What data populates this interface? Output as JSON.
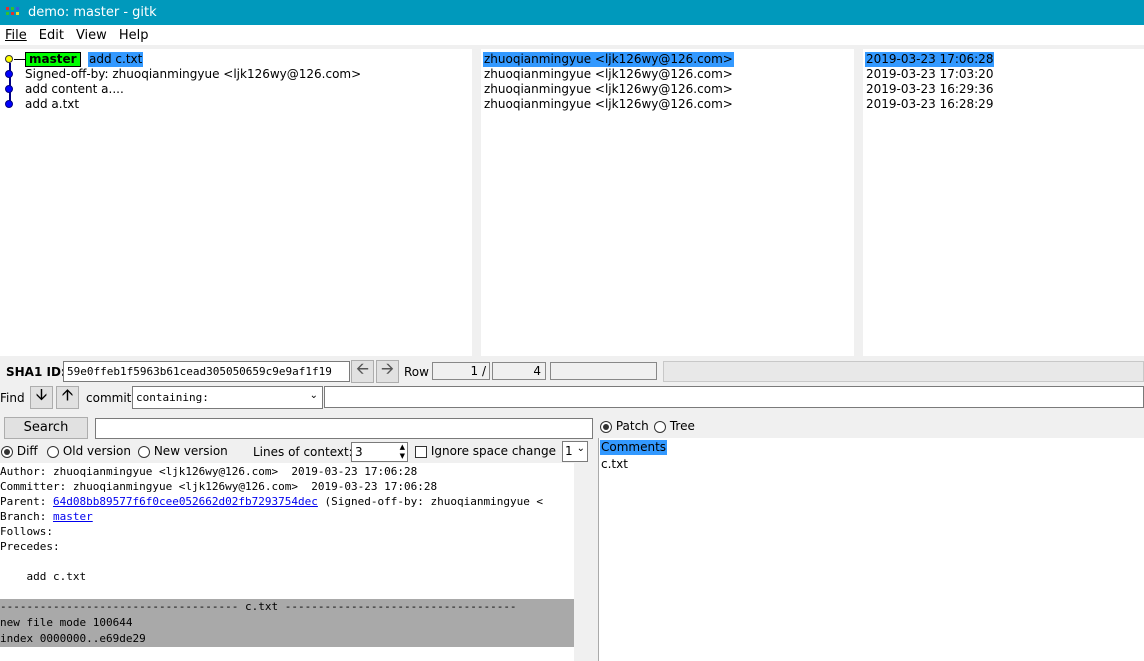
{
  "window": {
    "title": "demo: master - gitk"
  },
  "menu": [
    "File",
    "Edit",
    "View",
    "Help"
  ],
  "commits": [
    {
      "subject": "add c.txt",
      "branch": "master",
      "author": "zhuoqianmingyue <ljk126wy@126.com>",
      "date": "2019-03-23 17:06:28",
      "selected": true,
      "head": true
    },
    {
      "subject": "Signed-off-by: zhuoqianmingyue <ljk126wy@126.com>",
      "author": "zhuoqianmingyue <ljk126wy@126.com>",
      "date": "2019-03-23 17:03:20"
    },
    {
      "subject": "add content a....",
      "author": "zhuoqianmingyue <ljk126wy@126.com>",
      "date": "2019-03-23 16:29:36"
    },
    {
      "subject": "add a.txt",
      "author": "zhuoqianmingyue <ljk126wy@126.com>",
      "date": "2019-03-23 16:28:29"
    }
  ],
  "sha_bar": {
    "label": "SHA1 ID:",
    "value": "59e0ffeb1f5963b61cead305050659c9e9af1f19",
    "row_label": "Row",
    "row_current": "1 /",
    "row_total": "4"
  },
  "find_bar": {
    "find_label": "Find",
    "commit_label": "commit",
    "mode": "containing:",
    "query": ""
  },
  "search": {
    "button": "Search",
    "query": "",
    "diff_label": "Diff",
    "old_version_label": "Old version",
    "new_version_label": "New version",
    "context_label": "Lines of context:",
    "context_value": "3",
    "ignore_space_label": "Ignore space change",
    "extra_select": "1"
  },
  "details": {
    "author": "Author: zhuoqianmingyue <ljk126wy@126.com>  2019-03-23 17:06:28",
    "committer": "Committer: zhuoqianmingyue <ljk126wy@126.com>  2019-03-23 17:06:28",
    "parent_label": "Parent: ",
    "parent_sha": "64d08bb89577f6f0cee052662d02fb7293754dec",
    "parent_tail": " (Signed-off-by: zhuoqianmingyue <",
    "branch_label": "Branch: ",
    "branch_value": "master",
    "follows": "Follows:",
    "precedes": "Precedes:",
    "message": "    add c.txt",
    "file_header": "------------------------------------ c.txt -----------------------------------",
    "diff_line1": "new file mode 100644",
    "diff_line2": "index 0000000..e69de29"
  },
  "file_panel": {
    "patch_label": "Patch",
    "tree_label": "Tree",
    "items": [
      "Comments",
      "c.txt"
    ]
  },
  "colors": {
    "titlebar": "#0099bc",
    "selection": "#3399ff",
    "branch_tag": "#00ff00",
    "graph_line": "#00007f",
    "diff_header_bg": "#a9a9a9"
  }
}
